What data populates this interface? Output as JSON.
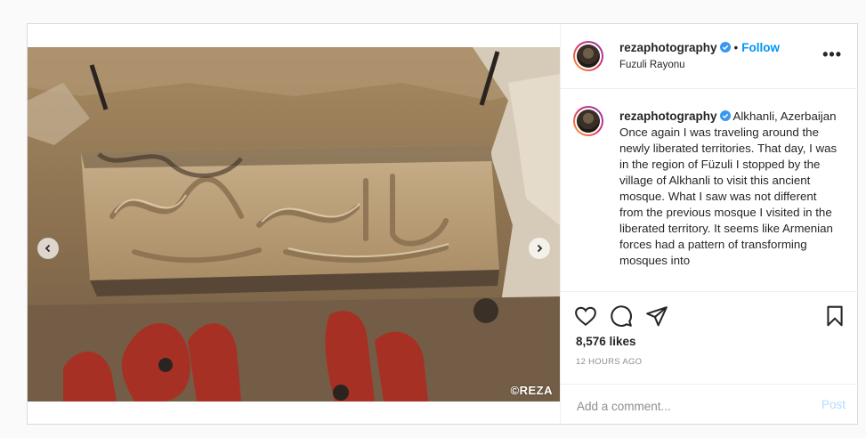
{
  "post": {
    "username": "rezaphotography",
    "follow_label": "Follow",
    "separator": "•",
    "header_location": "Fuzuli Rayonu",
    "caption_location": "Alkhanli, Azerbaijan",
    "caption_text": "Once again I was traveling around the newly liberated territories. That day, I was in the region of Füzuli I stopped by the village of Alkhanli to visit this ancient mosque. What I saw was not different from the previous mosque I visited in the liberated territory. It seems like Armenian forces had a pattern of transforming mosques into",
    "likes": "8,576 likes",
    "timestamp": "12 HOURS AGO",
    "comment_placeholder": "Add a comment...",
    "post_label": "Post",
    "watermark": "©REZA",
    "more_icon": "•••",
    "carousel": {
      "count": 10,
      "active_index": 5
    }
  },
  "colors": {
    "link": "#0095f6",
    "post_disabled": "#b3dbff",
    "verified": "#3897f0"
  },
  "icons": [
    "chevron-left-icon",
    "chevron-right-icon",
    "verified-icon",
    "more-icon",
    "heart-icon",
    "comment-icon",
    "share-icon",
    "bookmark-icon"
  ]
}
